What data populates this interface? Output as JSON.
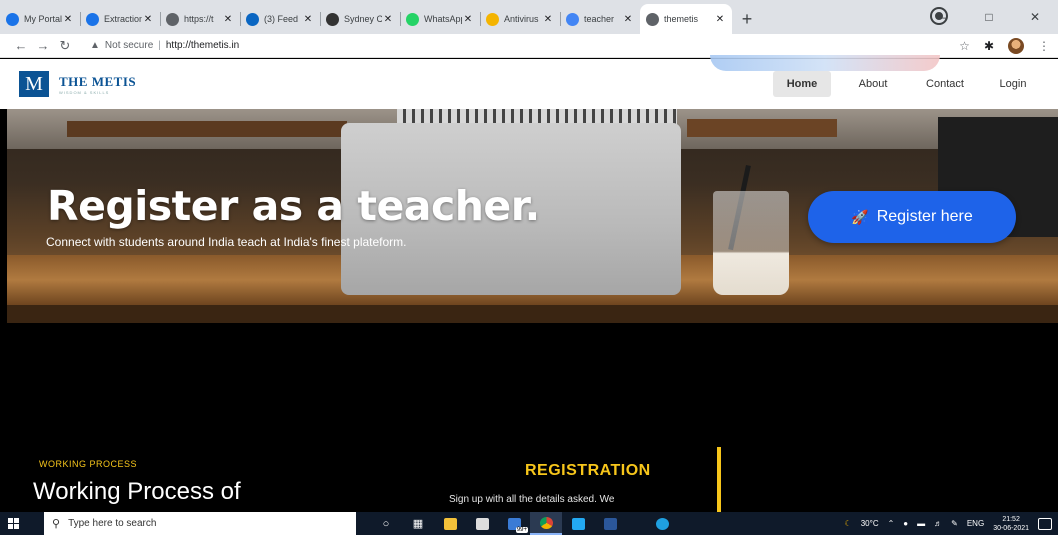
{
  "browser": {
    "tabs": [
      {
        "title": "My Portal",
        "favicon_color": "#1a73e8",
        "active": false
      },
      {
        "title": "Extraction",
        "favicon_color": "#1a73e8",
        "active": false
      },
      {
        "title": "https://t",
        "favicon_color": "#5f6368",
        "active": false
      },
      {
        "title": "(3) Feed",
        "favicon_color": "#0a66c2",
        "active": false
      },
      {
        "title": "Sydney C",
        "favicon_color": "#333333",
        "active": false
      },
      {
        "title": "WhatsApp",
        "favicon_color": "#25d366",
        "active": false
      },
      {
        "title": "Antivirus",
        "favicon_color": "#f4b400",
        "active": false
      },
      {
        "title": "teacher",
        "favicon_color": "#4285f4",
        "active": false
      },
      {
        "title": "themetis",
        "favicon_color": "#5f6368",
        "active": true
      }
    ],
    "new_tab_label": "+",
    "window_controls": {
      "minimize": "–",
      "maximize": "□",
      "close": "✕"
    },
    "security_label": "Not secure",
    "url": "http://themetis.in"
  },
  "site": {
    "logo": {
      "mark": "M",
      "name": "THE METIS",
      "tagline": "WISDOM & SKILLS"
    },
    "menu": {
      "home": "Home",
      "about": "About",
      "contact": "Contact",
      "login": "Login"
    },
    "hero": {
      "title": "Register as a teacher.",
      "subtitle": "Connect with students around India teach at India's finest plateform.",
      "button": "Register here"
    },
    "process": {
      "tag": "WORKING PROCESS",
      "title": "Working Process of",
      "registration_heading": "REGISTRATION",
      "registration_text": "Sign up with all the details asked. We"
    }
  },
  "taskbar": {
    "search_placeholder": "Type here to search",
    "badge": "99+",
    "weather": "30°C",
    "language": "ENG",
    "time": "21:52",
    "date": "30-06-2021"
  },
  "colors": {
    "accent_blue": "#1e63e9",
    "accent_yellow": "#f7c61b",
    "logo_blue": "#0b5394"
  }
}
